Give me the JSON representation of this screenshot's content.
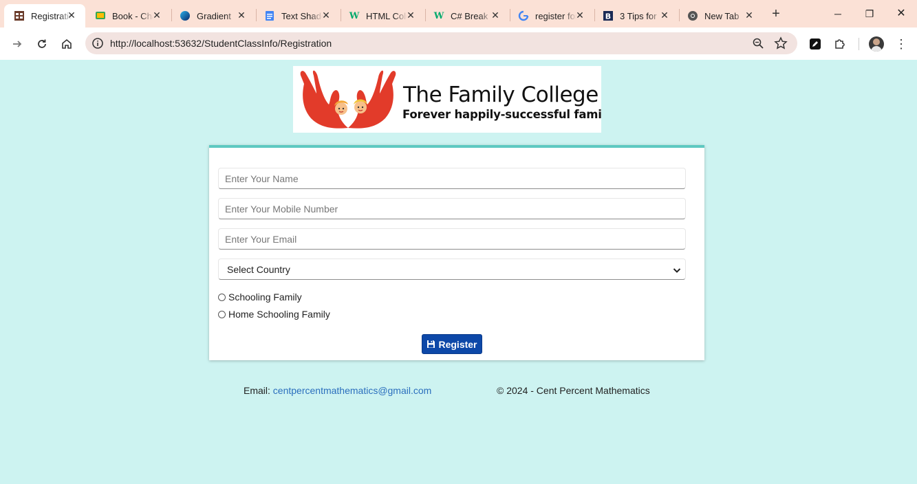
{
  "browser": {
    "tabs": [
      {
        "title": "Registration",
        "favicon": "table-icon",
        "active": true
      },
      {
        "title": "Book - Chat",
        "favicon": "chat-icon",
        "active": false
      },
      {
        "title": "Gradient",
        "favicon": "gradient-icon",
        "active": false
      },
      {
        "title": "Text Shadow",
        "favicon": "docs-icon",
        "active": false
      },
      {
        "title": "HTML Color",
        "favicon": "w3-icon",
        "active": false
      },
      {
        "title": "C# Break",
        "favicon": "w3-icon",
        "active": false
      },
      {
        "title": "register form",
        "favicon": "google-icon",
        "active": false
      },
      {
        "title": "3 Tips for",
        "favicon": "b-icon",
        "active": false
      },
      {
        "title": "New Tab",
        "favicon": "chrome-icon",
        "active": false
      }
    ],
    "url": "http://localhost:53632/StudentClassInfo/Registration"
  },
  "logo": {
    "title": "The Family College",
    "tagline": "Forever happily-successful families"
  },
  "form": {
    "name_placeholder": "Enter Your Name",
    "mobile_placeholder": "Enter Your Mobile Number",
    "email_placeholder": "Enter Your Email",
    "country_selected": "Select Country",
    "radio_options": [
      "Schooling Family",
      "Home Schooling Family"
    ],
    "register_label": "Register"
  },
  "footer": {
    "email_label": "Email:",
    "email": "centpercentmathematics@gmail.com",
    "copyright": "© 2024 - Cent Percent Mathematics"
  },
  "colors": {
    "page_bg": "#cdf3f1",
    "card_accent": "#5ec9c1",
    "button": "#0d48a8",
    "link": "#2a6ebd"
  }
}
